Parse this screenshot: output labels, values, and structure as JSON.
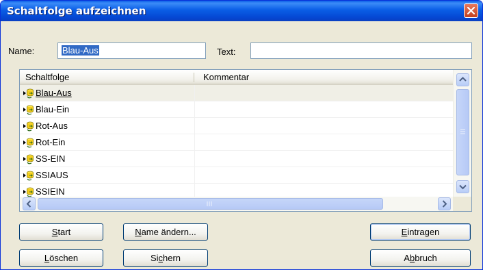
{
  "window": {
    "title": "Schaltfolge aufzeichnen"
  },
  "form": {
    "name_label": "Name:",
    "name_value": "Blau-Aus",
    "text_label": "Text:",
    "text_value": ""
  },
  "list": {
    "columns": [
      "Schaltfolge",
      "Kommentar"
    ],
    "rows": [
      {
        "name": "Blau-Aus",
        "comment": "",
        "selected": true
      },
      {
        "name": "Blau-Ein",
        "comment": ""
      },
      {
        "name": "Rot-Aus",
        "comment": ""
      },
      {
        "name": "Rot-Ein",
        "comment": ""
      },
      {
        "name": "SS-EIN",
        "comment": ""
      },
      {
        "name": "SSIAUS",
        "comment": ""
      },
      {
        "name": "SSIEIN",
        "comment": ""
      }
    ]
  },
  "buttons": {
    "start": {
      "mn": "S",
      "rest": "tart"
    },
    "rename": {
      "mn": "N",
      "rest": "ame ändern..."
    },
    "register": {
      "mn": "E",
      "rest": "intragen"
    },
    "delete": {
      "mn": "L",
      "rest": "öschen"
    },
    "save": {
      "pre": "Si",
      "mn": "c",
      "rest": "hern"
    },
    "cancel": {
      "pre": "A",
      "mn": "b",
      "rest": "bruch"
    }
  },
  "icons": {
    "close": "close-icon",
    "row": "cylinder-arrow-icon"
  },
  "colors": {
    "title_bar": "#0a5ee6",
    "selection": "#316ac5",
    "close": "#d8502e"
  }
}
